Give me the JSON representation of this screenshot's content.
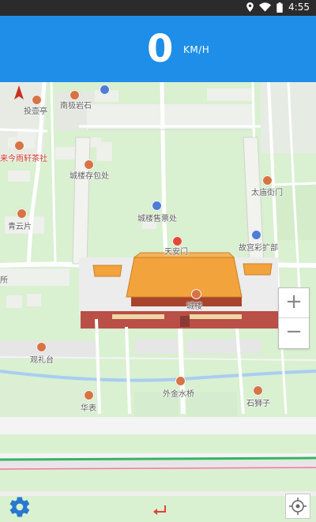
{
  "status": {
    "time": "4:55"
  },
  "speedometer": {
    "value": "0",
    "unit": "KM/H"
  },
  "map": {
    "pois": [
      {
        "name": "南极岩石"
      },
      {
        "name": "投壶亭"
      },
      {
        "name": "来今雨轩茶社"
      },
      {
        "name": "城楼存包处"
      },
      {
        "name": "青云片"
      },
      {
        "name": "城楼售票处"
      },
      {
        "name": "天安门"
      },
      {
        "name": "太庙街门"
      },
      {
        "name": "故宫彩扩部"
      },
      {
        "name": "城楼"
      },
      {
        "name": "观礼台"
      },
      {
        "name": "外金水桥"
      },
      {
        "name": "华表"
      },
      {
        "name": "石狮子"
      },
      {
        "name": "所"
      }
    ]
  },
  "controls": {
    "zoom_in": "+",
    "zoom_out": "−"
  },
  "colors": {
    "header": "#1f8ee8",
    "status_bar": "#2b2b2b",
    "park_green": "#d9f0d1",
    "river": "#a9cdf2",
    "roof": "#f2a33c",
    "wall_red": "#b94f47"
  }
}
